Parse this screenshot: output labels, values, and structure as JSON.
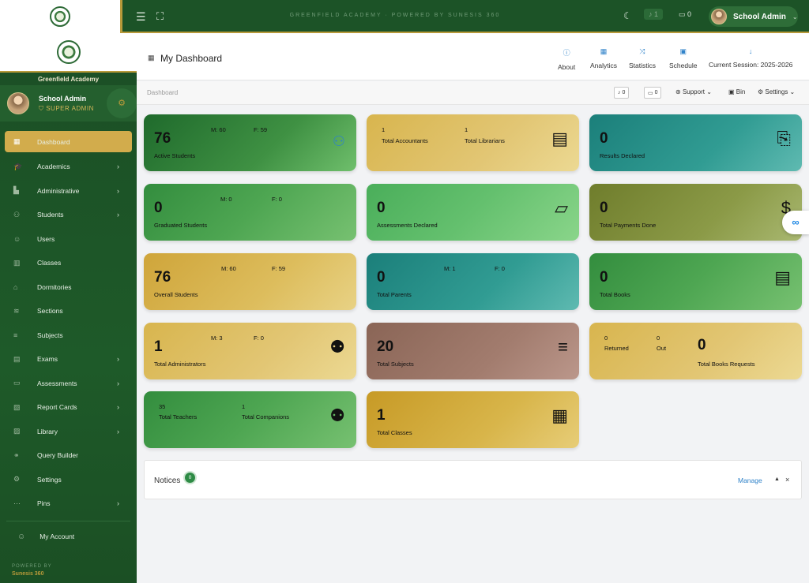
{
  "topbar": {
    "brand_text": "GREENFIELD ACADEMY · POWERED BY SUNESIS 360",
    "menu_icon": "☰",
    "fullscreen_icon": "⛶",
    "theme_icon": "☾",
    "notification_count": "1",
    "message_count": "0",
    "user_name": "School Admin",
    "caret": "⌄"
  },
  "sidebar": {
    "school_name": "Greenfield Academy",
    "profile_name": "School Admin",
    "profile_role": "⛉ SUPER ADMIN",
    "items": [
      {
        "label": "Dashboard",
        "icon": "▦",
        "icon_name": "dashboard-icon",
        "chevron": ""
      },
      {
        "label": "Academics",
        "icon": "🎓",
        "icon_name": "graduation-cap-icon",
        "chevron": "›"
      },
      {
        "label": "Administrative",
        "icon": "▙",
        "icon_name": "building-icon",
        "chevron": "›"
      },
      {
        "label": "Students",
        "icon": "⚇",
        "icon_name": "students-icon",
        "chevron": "›"
      },
      {
        "label": "Users",
        "icon": "☺",
        "icon_name": "user-icon",
        "chevron": ""
      },
      {
        "label": "Classes",
        "icon": "▥",
        "icon_name": "classes-icon",
        "chevron": ""
      },
      {
        "label": "Dormitories",
        "icon": "⌂",
        "icon_name": "dormitory-icon",
        "chevron": ""
      },
      {
        "label": "Sections",
        "icon": "≋",
        "icon_name": "layers-icon",
        "chevron": ""
      },
      {
        "label": "Subjects",
        "icon": "≡",
        "icon_name": "subjects-icon",
        "chevron": ""
      },
      {
        "label": "Exams",
        "icon": "▤",
        "icon_name": "exam-icon",
        "chevron": "›"
      },
      {
        "label": "Assessments",
        "icon": "▭",
        "icon_name": "folder-icon",
        "chevron": "›"
      },
      {
        "label": "Report Cards",
        "icon": "▧",
        "icon_name": "report-card-icon",
        "chevron": "›"
      },
      {
        "label": "Library",
        "icon": "▨",
        "icon_name": "library-icon",
        "chevron": "›"
      },
      {
        "label": "Query Builder",
        "icon": "⚭",
        "icon_name": "query-builder-icon",
        "chevron": ""
      },
      {
        "label": "Settings",
        "icon": "⚙",
        "icon_name": "settings-icon",
        "chevron": ""
      },
      {
        "label": "Pins",
        "icon": "⋯",
        "icon_name": "pins-icon",
        "chevron": "›"
      }
    ],
    "my_account": "My Account",
    "powered_by_label": "POWERED BY",
    "powered_by_name": "Sunesis 360"
  },
  "header": {
    "title": "My Dashboard",
    "links": [
      {
        "label": "About",
        "icon": "ⓘ"
      },
      {
        "label": "Analytics",
        "icon": "▦"
      },
      {
        "label": "Statistics",
        "icon": "⤨"
      },
      {
        "label": "Schedule",
        "icon": "▣"
      },
      {
        "label": "Current Session: 2025-2026",
        "icon": "↓"
      }
    ]
  },
  "toolbar": {
    "breadcrumb": "Dashboard",
    "alerts_count": "0",
    "messages_count": "0",
    "support": "Support",
    "bin": "Bin",
    "settings": "Settings"
  },
  "cards": {
    "active_students": {
      "value": "76",
      "label": "Active Students",
      "m": "M: 60",
      "f": "F: 59"
    },
    "accountants": {
      "acc_value": "1",
      "acc_label": "Total Accountants",
      "lib_value": "1",
      "lib_label": "Total Librarians"
    },
    "results": {
      "value": "0",
      "label": "Results Declared"
    },
    "graduated": {
      "value": "0",
      "label": "Graduated Students",
      "m": "M: 0",
      "f": "F: 0"
    },
    "assessments": {
      "value": "0",
      "label": "Assessments Declared"
    },
    "payments": {
      "value": "0",
      "label": "Total Payments Done"
    },
    "overall": {
      "value": "76",
      "label": "Overall Students",
      "m": "M: 60",
      "f": "F: 59"
    },
    "parents": {
      "value": "0",
      "label": "Total Parents",
      "m": "M: 1",
      "f": "F: 0"
    },
    "books": {
      "value": "0",
      "label": "Total Books"
    },
    "administrators": {
      "value": "1",
      "label": "Total Administrators",
      "m": "M: 3",
      "f": "F: 0"
    },
    "subjects": {
      "value": "20",
      "label": "Total Subjects"
    },
    "book_requests": {
      "returned_value": "0",
      "returned_label": "Returned",
      "out_value": "0",
      "out_label": "Out",
      "value": "0",
      "label": "Total Books Requests"
    },
    "teachers": {
      "teachers_value": "35",
      "teachers_label": "Total Teachers",
      "companions_value": "1",
      "companions_label": "Total Companions"
    },
    "classes": {
      "value": "1",
      "label": "Total Classes"
    }
  },
  "notices": {
    "title": "Notices",
    "count": "0",
    "manage": "Manage"
  }
}
